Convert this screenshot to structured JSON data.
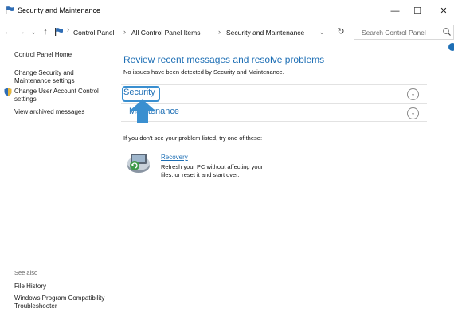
{
  "window": {
    "title": "Security and Maintenance",
    "minimize": "—",
    "maximize": "☐",
    "close": "✕"
  },
  "nav": {
    "back": "←",
    "forward": "→",
    "recent": "⌄",
    "up": "↑",
    "refresh": "↻",
    "dropdown": "⌄"
  },
  "breadcrumb": {
    "items": [
      "Control Panel",
      "All Control Panel Items",
      "Security and Maintenance"
    ],
    "separator": "›"
  },
  "search": {
    "placeholder": "Search Control Panel"
  },
  "sidebar": {
    "home": "Control Panel Home",
    "change_security": "Change Security and Maintenance settings",
    "change_uac": "Change User Account Control settings",
    "archived": "View archived messages",
    "see_also": "See also",
    "file_history": "File History",
    "compat": "Windows Program Compatibility Troubleshooter"
  },
  "main": {
    "heading": "Review recent messages and resolve problems",
    "status": "No issues have been detected by Security and Maintenance.",
    "sections": [
      {
        "label_first": "S",
        "label_rest": "ecurity"
      },
      {
        "label_first": "M",
        "label_mid": "a",
        "label_rest": "intenance"
      }
    ],
    "chevron": "⌄",
    "if_not": "If you don't see your problem listed, try one of these:",
    "recovery": {
      "link": "Recovery",
      "description": "Refresh your PC without affecting your files, or reset it and start over."
    }
  },
  "colors": {
    "accent": "#1e6fb5",
    "highlight": "#3a8fd0"
  }
}
